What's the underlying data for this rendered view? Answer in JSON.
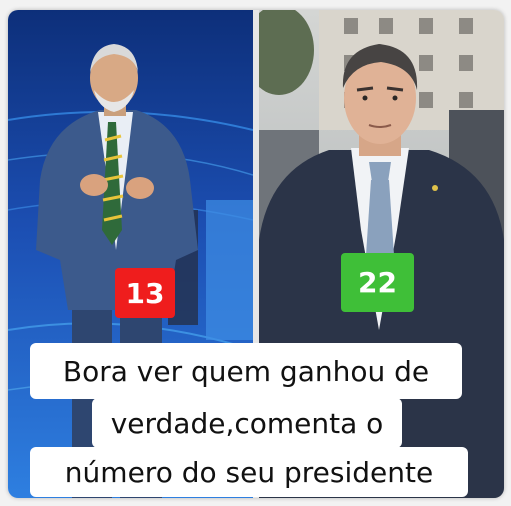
{
  "candidates": [
    {
      "number": "13",
      "badge_color": "#ef1d1d"
    },
    {
      "number": "22",
      "badge_color": "#3fbf38"
    }
  ],
  "caption": {
    "line1": "Bora ver quem ganhou de",
    "line2": "verdade,comenta o",
    "line3": "número do seu presidente"
  },
  "colors": {
    "left_background": "#1c4fb3",
    "right_background": "#b9bcbe"
  }
}
